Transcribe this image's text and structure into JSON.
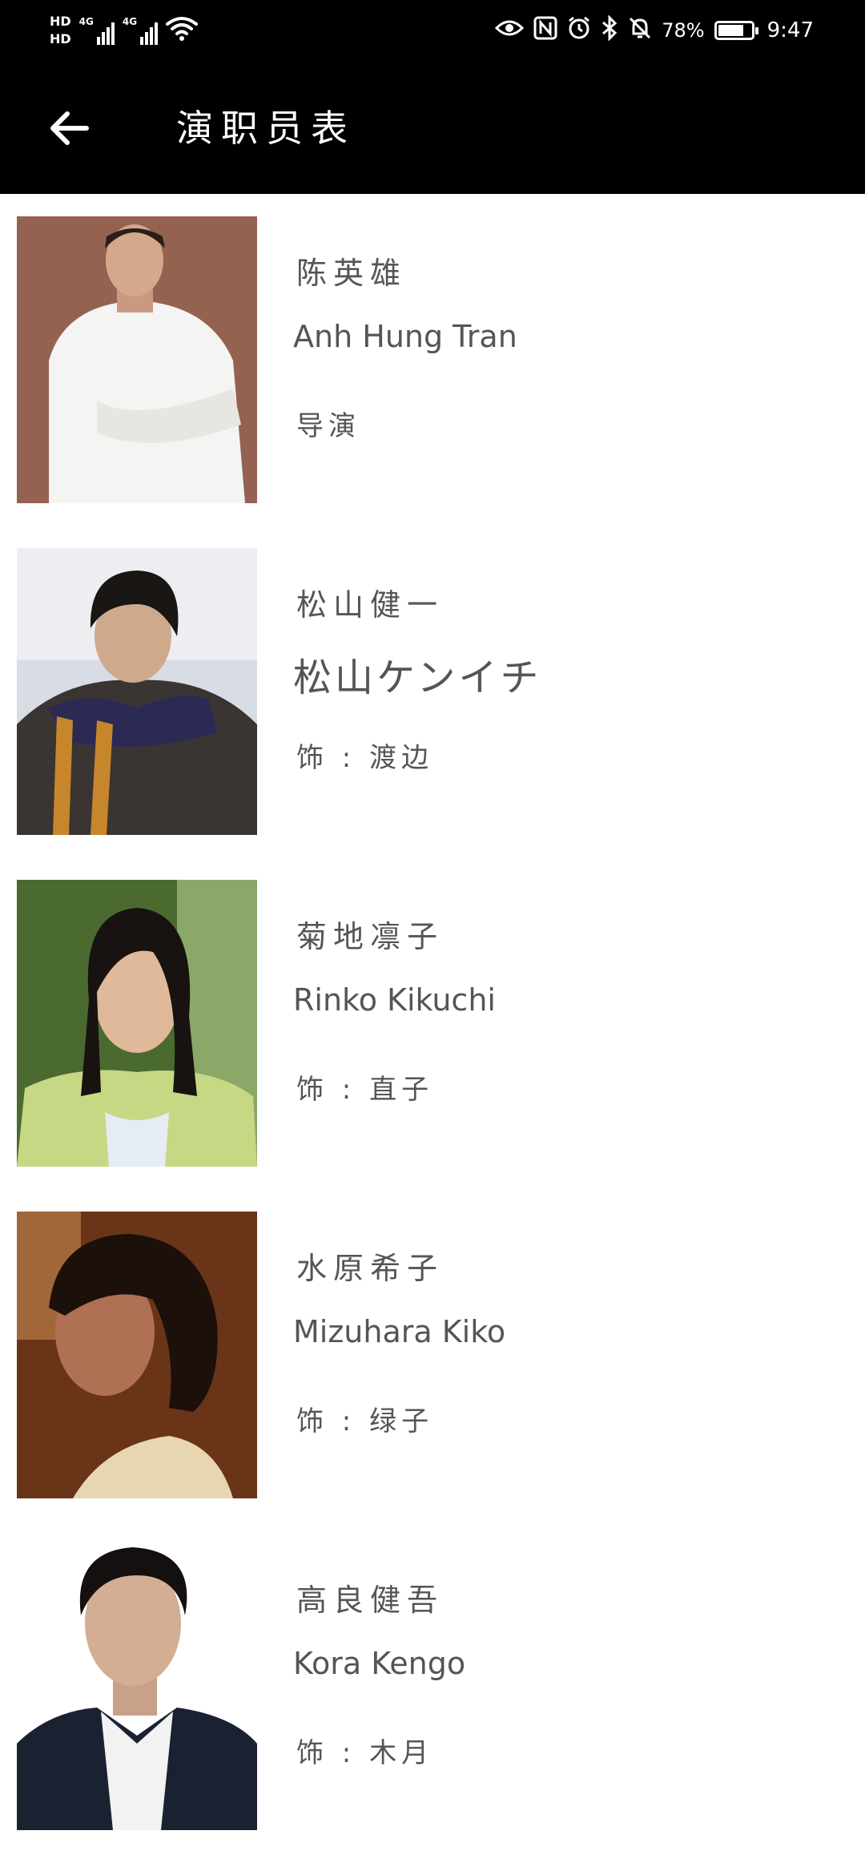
{
  "status_bar": {
    "hd1": "HD",
    "hd2": "HD",
    "net1": "4G",
    "net2": "4G",
    "battery_level": 0.78,
    "battery_text": "78%",
    "time": "9:47"
  },
  "app_bar": {
    "title": "演职员表"
  },
  "cast": [
    {
      "name_cn": "陈英雄",
      "name_en": "Anh Hung Tran",
      "role": "导演"
    },
    {
      "name_cn": "松山健一",
      "name_en": "松山ケンイチ",
      "role": "饰 : 渡边"
    },
    {
      "name_cn": "菊地凛子",
      "name_en": "Rinko Kikuchi",
      "role": "饰 : 直子"
    },
    {
      "name_cn": "水原希子",
      "name_en": "Mizuhara Kiko",
      "role": "饰 : 绿子"
    },
    {
      "name_cn": "高良健吾",
      "name_en": "Kora Kengo",
      "role": "饰 : 木月"
    }
  ],
  "icons": {
    "back": "arrow-left-icon",
    "eye": "eye-icon",
    "nfc": "nfc-icon",
    "alarm": "alarm-icon",
    "bluetooth": "bluetooth-icon",
    "mute": "bell-off-icon",
    "battery": "battery-icon",
    "wifi": "wifi-icon"
  },
  "colors": {
    "header_bg": "#000000",
    "text_secondary": "#555555",
    "page_bg": "#ffffff"
  }
}
